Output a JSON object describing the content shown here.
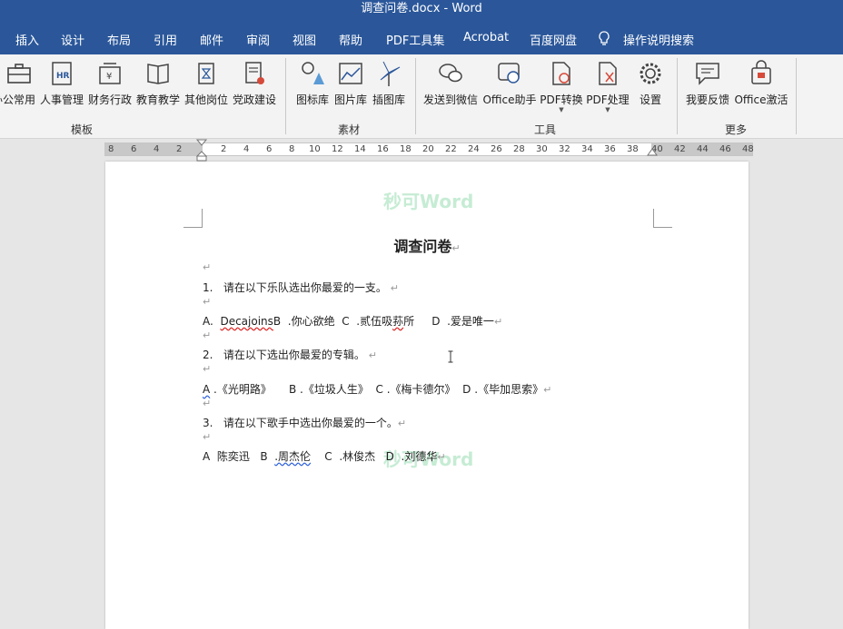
{
  "window": {
    "title": "调查问卷.docx  -  Word"
  },
  "menu": {
    "items": [
      "插入",
      "设计",
      "布局",
      "引用",
      "邮件",
      "审阅",
      "视图",
      "帮助",
      "PDF工具集",
      "Acrobat",
      "百度网盘"
    ],
    "search_label": "操作说明搜索"
  },
  "ribbon": {
    "buttons": [
      "办公常用",
      "人事管理",
      "财务行政",
      "教育教学",
      "其他岗位",
      "党政建设",
      "图标库",
      "图片库",
      "插图库",
      "发送到微信",
      "Office助手",
      "PDF转换",
      "PDF处理",
      "设置",
      "我要反馈",
      "Office激活"
    ],
    "groups": [
      "模板",
      "素材",
      "工具",
      "更多"
    ]
  },
  "ruler": {
    "ticks": [
      "8",
      "6",
      "4",
      "2",
      "2",
      "4",
      "6",
      "8",
      "10",
      "12",
      "14",
      "16",
      "18",
      "20",
      "22",
      "24",
      "26",
      "28",
      "30",
      "32",
      "34",
      "36",
      "38",
      "40",
      "42",
      "44",
      "46",
      "48"
    ]
  },
  "document": {
    "watermark": "秒可Word",
    "title": "调查问卷",
    "para_mark": "↵",
    "q1": {
      "num": "1.",
      "text": "请在以下乐队选出你最爱的一支。"
    },
    "q1_opts": {
      "a": "A.",
      "a_text": "Decajoins",
      "b": "B",
      "b_text": ".你心欲绝",
      "c": "C",
      "c_text": ".贰伍吸",
      "c_text2": "荪",
      "c_text3": "所",
      "d": "D",
      "d_text": ".爱是唯一"
    },
    "q2": {
      "num": "2.",
      "text": "请在以下选出你最爱的专辑。"
    },
    "q2_opts": {
      "a": "A",
      "a_text": ".《光明路》",
      "b": "B",
      "b_text": ".《垃圾人生》",
      "c": "C",
      "c_text": ".《梅卡德尔》",
      "d": "D",
      "d_text": ".《毕加思索》"
    },
    "q3": {
      "num": "3.",
      "text": "请在以下歌手中选出你最爱的一个。"
    },
    "q3_opts": {
      "a": "A",
      "a_text": "陈奕迅",
      "b": "B",
      "b_text": ".周杰伦",
      "c": "C",
      "c_text": ".林俊杰",
      "d": "D",
      "d_text": ".刘德华"
    }
  },
  "colors": {
    "ribbon_blue": "#2b579a",
    "watermark": "#c6ecd4"
  }
}
